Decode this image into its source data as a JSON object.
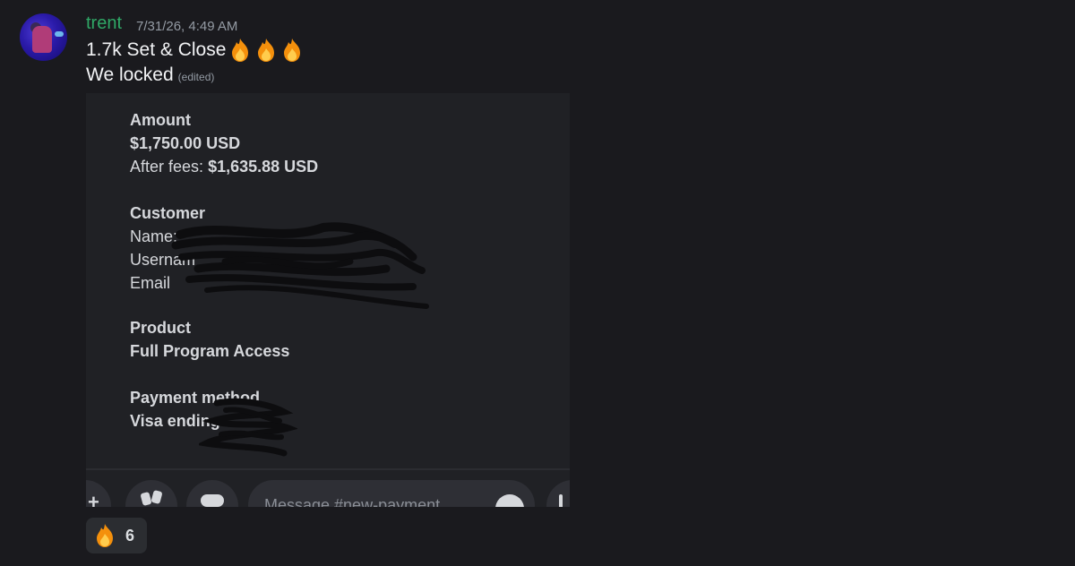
{
  "message": {
    "author": "trent",
    "timestamp": "7/31/26, 4:49 AM",
    "line1": "1.7k Set & Close",
    "line1_emoji": [
      "fire-emoji",
      "fire-emoji",
      "fire-emoji"
    ],
    "line2": "We locked",
    "edited": "(edited)"
  },
  "embed": {
    "amount_header": "Amount",
    "amount_value": "$1,750.00 USD",
    "after_fees_label": "After fees:",
    "after_fees_value": "$1,635.88 USD",
    "customer_header": "Customer",
    "name_label": "Name:",
    "username_label": "Usernam",
    "email_label": "Email",
    "product_header": "Product",
    "product_value": "Full Program Access",
    "payment_header": "Payment method",
    "payment_value": "Visa ending"
  },
  "composer": {
    "placeholder": "Message #new-payment"
  },
  "reaction": {
    "emoji": "fire-emoji",
    "count": "6"
  },
  "colors": {
    "background": "#1a1a1e",
    "author": "#2fa866",
    "embed_bg": "#202125",
    "reaction_bg": "#2b2d31"
  }
}
